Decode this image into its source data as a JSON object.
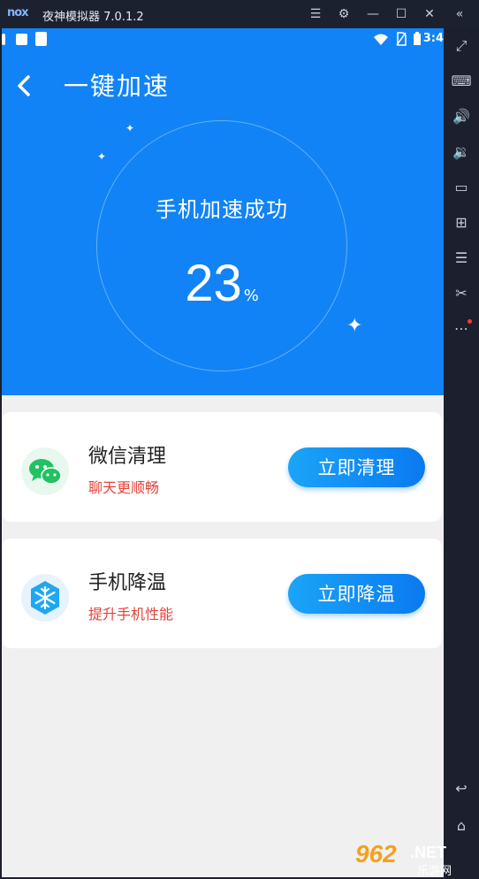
{
  "emulator": {
    "logo": "nox",
    "title": "夜神模拟器 7.0.1.2",
    "buttons": [
      "menu-icon",
      "gear-icon",
      "minimize-icon",
      "maximize-icon",
      "close-icon",
      "collapse-icon"
    ]
  },
  "statusbar": {
    "time": "3:4"
  },
  "header": {
    "title": "一键加速"
  },
  "result": {
    "label": "手机加速成功",
    "percent": "23",
    "unit": "%"
  },
  "cards": [
    {
      "title": "微信清理",
      "subtitle": "聊天更顺畅",
      "button": "立即清理",
      "icon": "wechat-icon"
    },
    {
      "title": "手机降温",
      "subtitle": "提升手机性能",
      "button": "立即降温",
      "icon": "snowflake-icon"
    }
  ],
  "watermark": {
    "text": "962",
    "suffix": ".NET",
    "sub": "乐游网"
  },
  "colors": {
    "accent": "#1183f6",
    "button": "#0a7af0",
    "subtitle": "#e2433a",
    "wechat": "#20c262"
  }
}
